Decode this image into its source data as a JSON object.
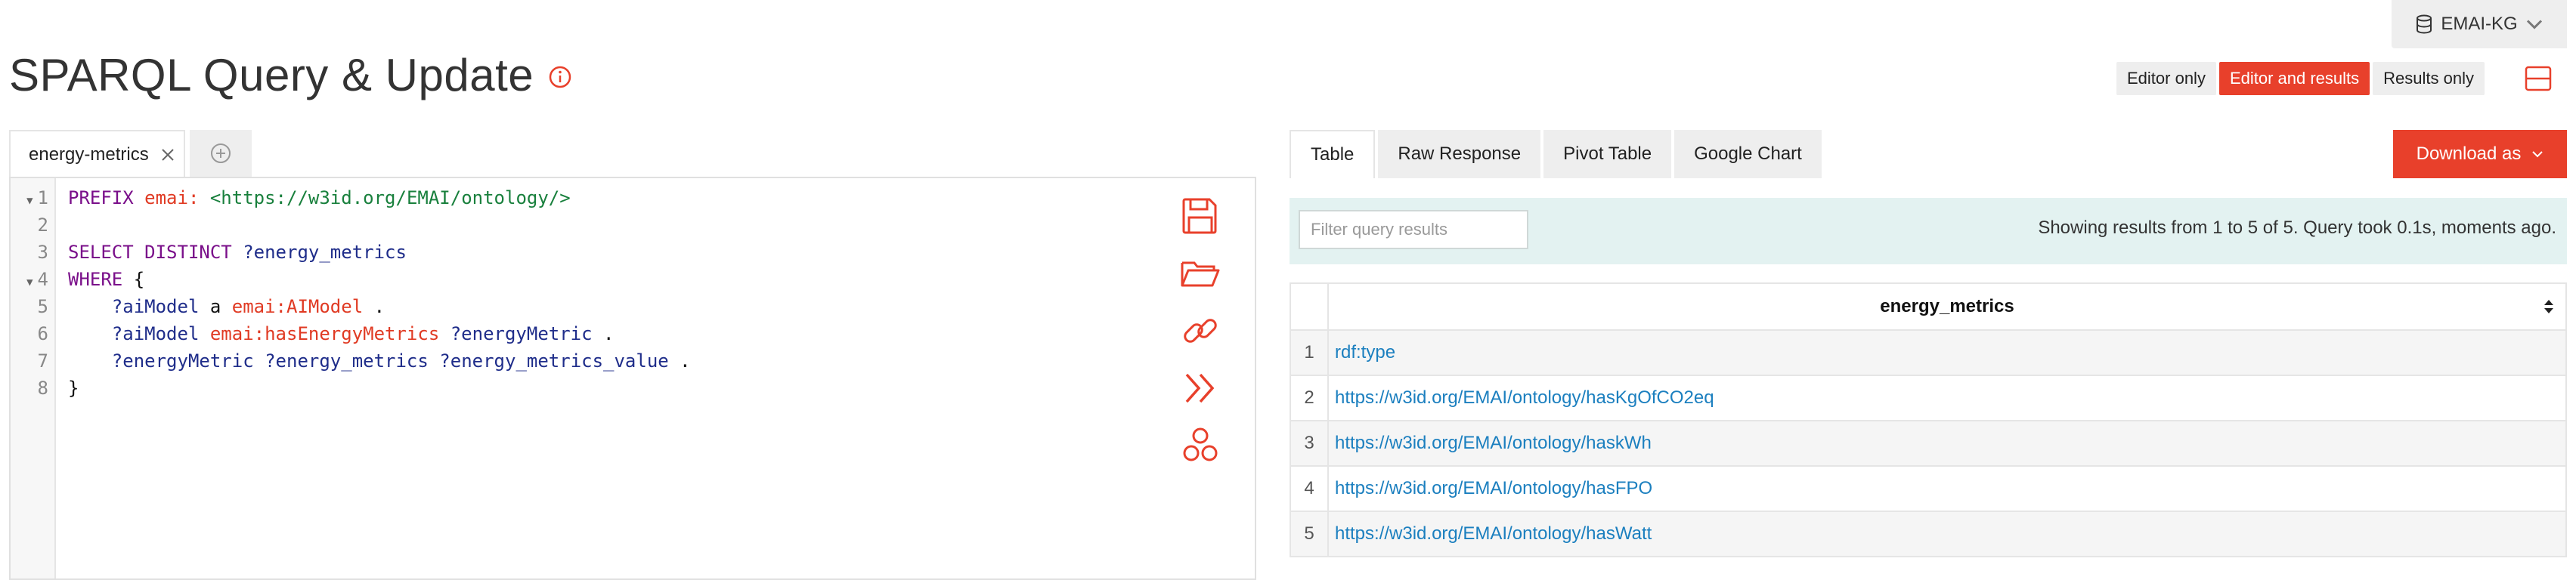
{
  "header": {
    "repository": "EMAI-KG",
    "title": "SPARQL Query & Update",
    "view_modes": [
      {
        "label": "Editor only",
        "active": false
      },
      {
        "label": "Editor and results",
        "active": true
      },
      {
        "label": "Results only",
        "active": false
      }
    ]
  },
  "editor": {
    "tab_label": "energy-metrics",
    "line_numbers": [
      "1",
      "2",
      "3",
      "4",
      "5",
      "6",
      "7",
      "8"
    ],
    "code_lines": [
      "PREFIX emai: <https://w3id.org/EMAI/ontology/>",
      "",
      "SELECT DISTINCT ?energy_metrics",
      "WHERE {",
      "    ?aiModel a emai:AIModel .",
      "    ?aiModel emai:hasEnergyMetrics ?energyMetric .",
      "    ?energyMetric ?energy_metrics ?energy_metrics_value .",
      "}"
    ]
  },
  "results": {
    "tabs": [
      {
        "label": "Table",
        "active": true
      },
      {
        "label": "Raw Response",
        "active": false
      },
      {
        "label": "Pivot Table",
        "active": false
      },
      {
        "label": "Google Chart",
        "active": false
      }
    ],
    "download_label": "Download as",
    "filter_placeholder": "Filter query results",
    "status": "Showing results from 1 to 5 of 5. Query took 0.1s, moments ago.",
    "column": "energy_metrics",
    "rows": [
      {
        "num": "1",
        "value": "rdf:type"
      },
      {
        "num": "2",
        "value": "https://w3id.org/EMAI/ontology/hasKgOfCO2eq"
      },
      {
        "num": "3",
        "value": "https://w3id.org/EMAI/ontology/haskWh"
      },
      {
        "num": "4",
        "value": "https://w3id.org/EMAI/ontology/hasFPO"
      },
      {
        "num": "5",
        "value": "https://w3id.org/EMAI/ontology/hasWatt"
      }
    ]
  },
  "colors": {
    "accent": "#e8402b",
    "info_bar": "#e3f2f1",
    "link": "#1b7fbf"
  },
  "icons": [
    "database-icon",
    "chevron-down-icon",
    "info-icon",
    "layout-split-icon",
    "close-icon",
    "add-tab-icon",
    "save-icon",
    "folder-open-icon",
    "link-icon",
    "expand-icon",
    "share-icon",
    "sort-icon"
  ]
}
